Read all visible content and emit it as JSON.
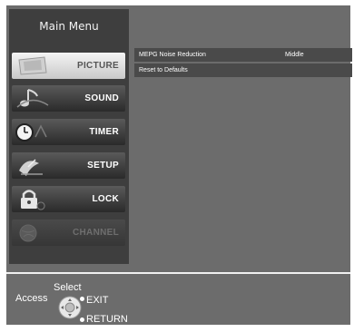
{
  "menu": {
    "title": "Main Menu",
    "items": [
      {
        "label": "PICTURE",
        "icon": "picture-icon",
        "state": "selected"
      },
      {
        "label": "SOUND",
        "icon": "music-note-icon",
        "state": "normal"
      },
      {
        "label": "TIMER",
        "icon": "clock-icon",
        "state": "normal"
      },
      {
        "label": "SETUP",
        "icon": "satellite-dish-icon",
        "state": "normal"
      },
      {
        "label": "LOCK",
        "icon": "padlock-icon",
        "state": "normal"
      },
      {
        "label": "CHANNEL",
        "icon": "globe-icon",
        "state": "disabled"
      }
    ]
  },
  "settings": [
    {
      "name": "MEPG Noise Reduction",
      "value": "Middle"
    },
    {
      "name": "Reset to Defaults",
      "value": ""
    }
  ],
  "footer": {
    "select": "Select",
    "access": "Access",
    "exit": "EXIT",
    "return": "RETURN"
  },
  "colors": {
    "screen_bg": "#6c6c6c",
    "menu_bg": "#3e3e3e",
    "row_bg": "#4a4a4a",
    "selected_item": "#e6e6e6"
  }
}
